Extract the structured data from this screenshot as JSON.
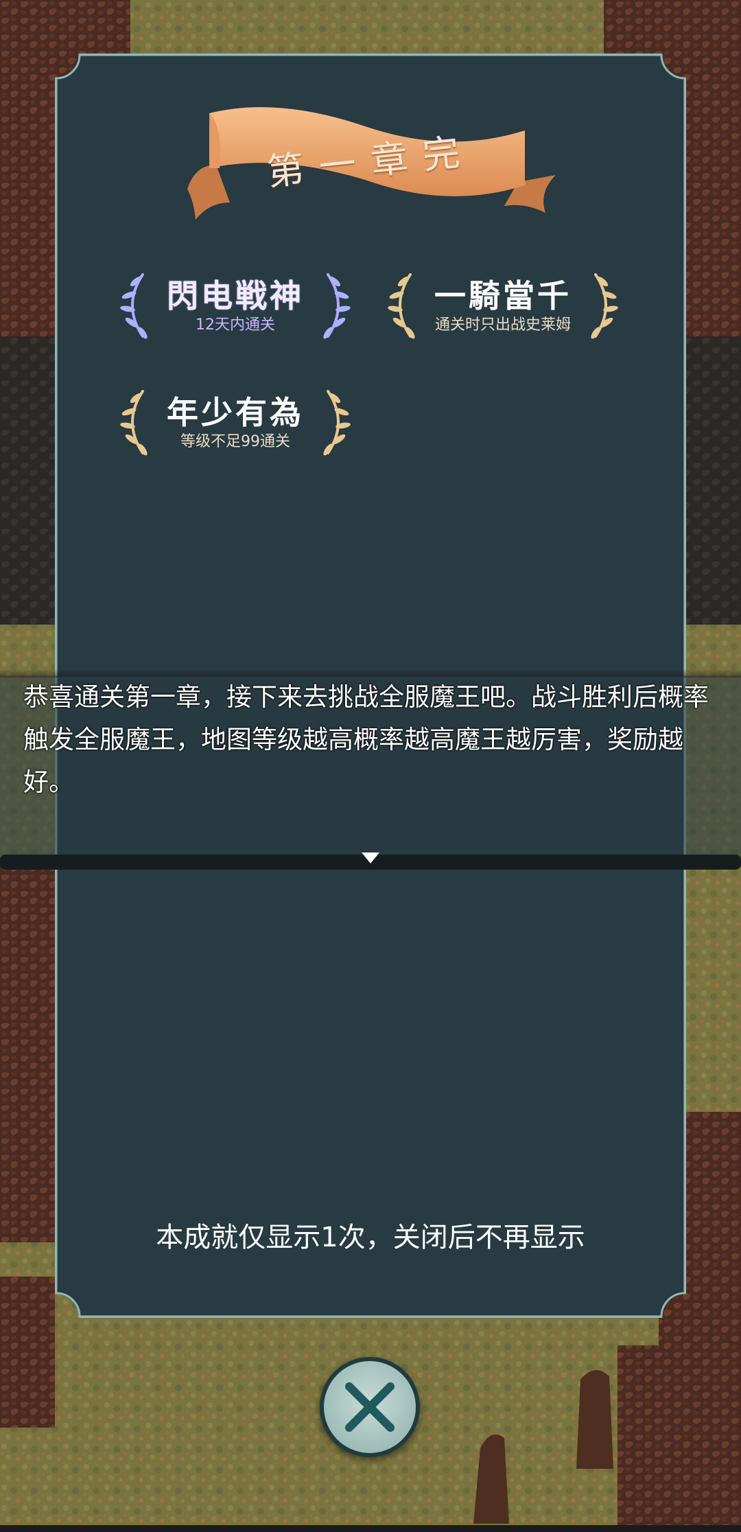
{
  "banner": {
    "title": "第一章完"
  },
  "achievements": [
    {
      "title": "閃电戦神",
      "subtitle": "12天内通关",
      "style": "purple"
    },
    {
      "title": "一騎當千",
      "subtitle": "通关时只出战史莱姆",
      "style": "gold"
    },
    {
      "title": "年少有為",
      "subtitle": "等级不足99通关",
      "style": "gold"
    }
  ],
  "message": {
    "text": "恭喜通关第一章，接下来去挑战全服魔王吧。战斗胜利后概率触发全服魔王，地图等级越高概率越高魔王越厉害，奖励越好。"
  },
  "note": "本成就仅显示1次，关闭后不再显示",
  "icons": {
    "close": "close-icon",
    "continue": "continue-arrow-icon",
    "laurel": "laurel-icon"
  },
  "colors": {
    "panel": "#283a42",
    "panel_border": "#8fb9b8",
    "ribbon": "#f0a46a",
    "gold": "#e7c98f",
    "purple": "#b7a5ff"
  }
}
